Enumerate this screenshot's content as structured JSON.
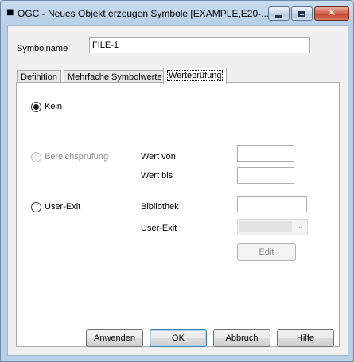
{
  "window": {
    "title": "OGC - Neues Objekt erzeugen Symbole [EXAMPLE,E20-...",
    "icon": "app-icon"
  },
  "form": {
    "symbolname_label": "Symbolname",
    "symbolname_value": "FILE-1"
  },
  "tabs": [
    {
      "label": "Definition",
      "active": false
    },
    {
      "label": "Mehrfache Symbolwerte",
      "active": false
    },
    {
      "label": "Werteprüfung",
      "active": true
    }
  ],
  "validation": {
    "kein_label": "Kein",
    "kein_selected": true,
    "bereich_label": "Bereichsprüfung",
    "bereich_enabled": false,
    "wert_von_label": "Wert von",
    "wert_von_value": "",
    "wert_bis_label": "Wert bis",
    "wert_bis_value": "",
    "userexit_label": "User-Exit",
    "bibliothek_label": "Bibliothek",
    "bibliothek_value": "",
    "userexit_field_label": "User-Exit",
    "userexit_selected": "",
    "edit_button": "Edit"
  },
  "buttons": {
    "anwenden": "Anwenden",
    "ok": "OK",
    "abbruch": "Abbruch",
    "hilfe": "Hilfe"
  }
}
